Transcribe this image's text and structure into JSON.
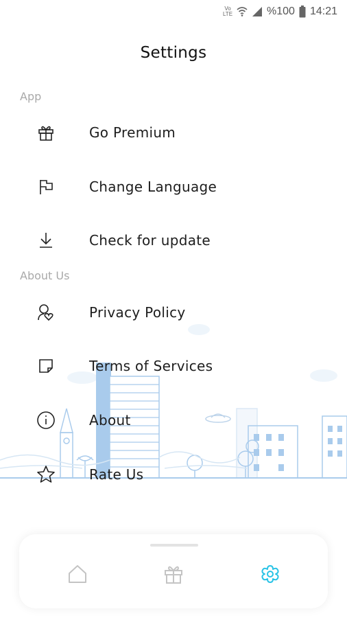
{
  "status_bar": {
    "network_label": "VoLTE",
    "battery_text": "%100",
    "time": "14:21"
  },
  "header": {
    "title": "Settings"
  },
  "sections": [
    {
      "label": "App",
      "items": [
        {
          "label": "Go Premium",
          "icon": "gift-icon"
        },
        {
          "label": "Change Language",
          "icon": "flag-icon"
        },
        {
          "label": "Check for update",
          "icon": "download-icon"
        }
      ]
    },
    {
      "label": "About Us",
      "items": [
        {
          "label": "Privacy Policy",
          "icon": "privacy-icon"
        },
        {
          "label": "Terms of Services",
          "icon": "note-icon"
        },
        {
          "label": "About",
          "icon": "info-icon"
        },
        {
          "label": "Rate Us",
          "icon": "star-icon"
        }
      ]
    }
  ],
  "bottom_nav": {
    "items": [
      {
        "icon": "home-icon",
        "active": false
      },
      {
        "icon": "gift-icon",
        "active": false
      },
      {
        "icon": "settings-flower-icon",
        "active": true
      }
    ],
    "active_color": "#29c3e6",
    "inactive_color": "#c4c4c4"
  },
  "colors": {
    "section_label": "#a9a9a9",
    "illustration": "#bfd7ee"
  }
}
